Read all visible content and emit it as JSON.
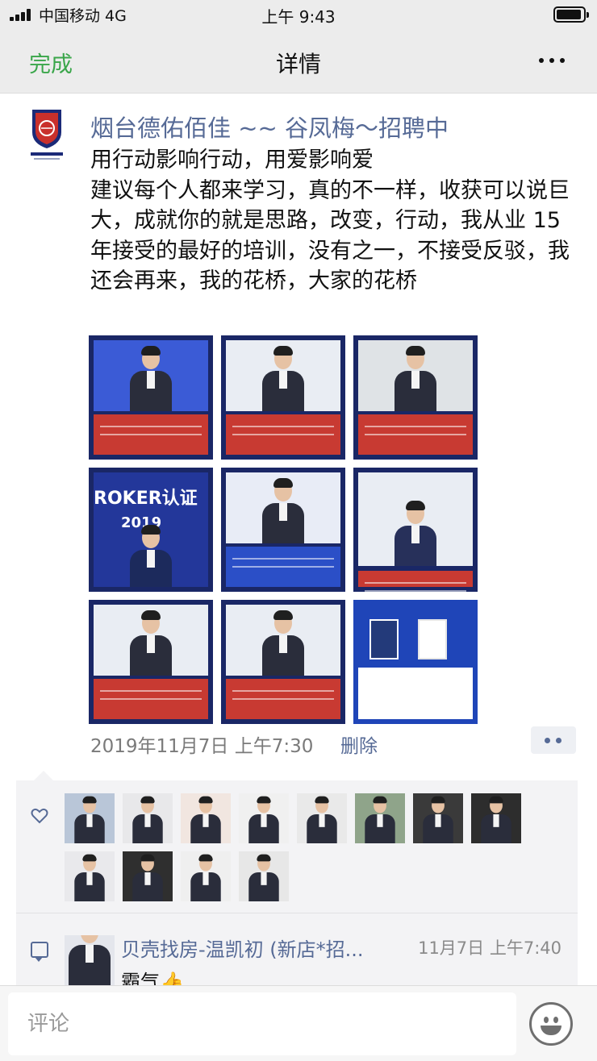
{
  "status_bar": {
    "carrier": "中国移动  4G",
    "time": "上午 9:43"
  },
  "nav": {
    "done_label": "完成",
    "title": "详情",
    "more_icon": "more-dots-icon"
  },
  "post": {
    "author": "烟台德佑佰佳 ~~ 谷凤梅～招聘中",
    "text": "用行动影响行动，用爱影响爱\n建议每个人都来学习，真的不一样，收获可以说巨大，成就你的就是思路，改变，行动，我从业 15 年接受的最好的培训，没有之一，不接受反驳，我还会再来，我的花桥，大家的花桥",
    "photo_texts": {
      "p4_banner": "ROKER认证",
      "p4_sub": "2019"
    },
    "time": "2019年11月7日 上午7:30",
    "delete_label": "删除"
  },
  "likes": {
    "count": 12
  },
  "comment": {
    "author": "贝壳找房-温凯初 (新店*招...",
    "time": "11月7日 上午7:40",
    "text": "霸气👍"
  },
  "input": {
    "placeholder": "评论"
  },
  "colors": {
    "link": "#566a96",
    "done": "#3aa64a",
    "photo_frame": "#1a2766",
    "photo_panel": "#c83a32"
  }
}
